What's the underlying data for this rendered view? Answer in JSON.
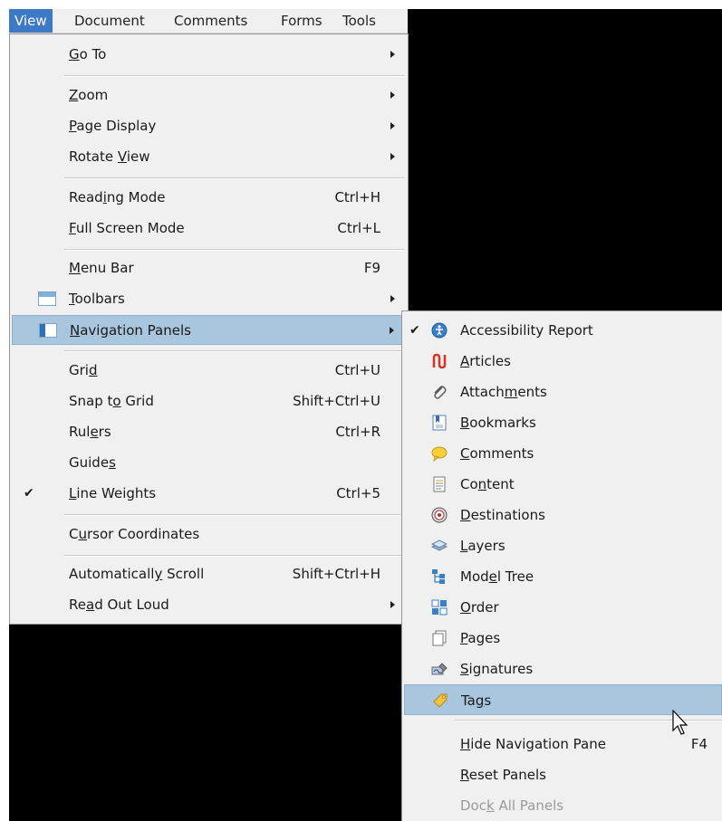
{
  "menubar": {
    "items": [
      "View",
      "Document",
      "Comments",
      "Forms",
      "Tools"
    ],
    "active_index": 0,
    "accent": "#3d79c4"
  },
  "view_menu": {
    "items": [
      {
        "label": "Go To",
        "mnemonic": "G",
        "submenu": true
      },
      {
        "label": "Zoom",
        "mnemonic": "Z",
        "submenu": true
      },
      {
        "label": "Page Display",
        "mnemonic": "P",
        "submenu": true
      },
      {
        "label": "Rotate View",
        "mnemonic": "V",
        "submenu": true
      },
      {
        "label": "Reading Mode",
        "mnemonic": "i",
        "shortcut": "Ctrl+H"
      },
      {
        "label": "Full Screen Mode",
        "mnemonic": "F",
        "shortcut": "Ctrl+L"
      },
      {
        "label": "Menu Bar",
        "mnemonic": "M",
        "shortcut": "F9"
      },
      {
        "label": "Toolbars",
        "mnemonic": "T",
        "submenu": true,
        "icon": "toolbars-icon"
      },
      {
        "label": "Navigation Panels",
        "mnemonic": "N",
        "submenu": true,
        "icon": "navigation-panels-icon",
        "highlighted": true
      },
      {
        "label": "Grid",
        "mnemonic": "d",
        "shortcut": "Ctrl+U"
      },
      {
        "label": "Snap to Grid",
        "mnemonic": "o",
        "shortcut": "Shift+Ctrl+U"
      },
      {
        "label": "Rulers",
        "mnemonic": "e",
        "shortcut": "Ctrl+R"
      },
      {
        "label": "Guides",
        "mnemonic": "s"
      },
      {
        "label": "Line Weights",
        "mnemonic": "L",
        "shortcut": "Ctrl+5",
        "checked": true
      },
      {
        "label": "Cursor Coordinates",
        "mnemonic": "u"
      },
      {
        "label": "Automatically Scroll",
        "mnemonic": "y",
        "shortcut": "Shift+Ctrl+H"
      },
      {
        "label": "Read Out Loud",
        "mnemonic": "a",
        "submenu": true
      }
    ]
  },
  "nav_submenu": {
    "items": [
      {
        "label": "Accessibility Report",
        "icon": "accessibility-report-icon",
        "checked": true
      },
      {
        "label": "Articles",
        "mnemonic": "A",
        "icon": "articles-icon"
      },
      {
        "label": "Attachments",
        "mnemonic": "m",
        "icon": "paperclip-icon"
      },
      {
        "label": "Bookmarks",
        "mnemonic": "B",
        "icon": "bookmarks-icon"
      },
      {
        "label": "Comments",
        "mnemonic": "C",
        "icon": "comment-bubble-icon"
      },
      {
        "label": "Content",
        "mnemonic": "n",
        "icon": "content-icon"
      },
      {
        "label": "Destinations",
        "mnemonic": "D",
        "icon": "destinations-icon"
      },
      {
        "label": "Layers",
        "mnemonic": "L",
        "icon": "layers-icon"
      },
      {
        "label": "Model Tree",
        "mnemonic": "e",
        "icon": "model-tree-icon"
      },
      {
        "label": "Order",
        "mnemonic": "O",
        "icon": "order-icon"
      },
      {
        "label": "Pages",
        "mnemonic": "P",
        "icon": "pages-icon"
      },
      {
        "label": "Signatures",
        "mnemonic": "S",
        "icon": "signatures-icon"
      },
      {
        "label": "Tags",
        "mnemonic": "g",
        "icon": "tag-icon",
        "highlighted": true
      },
      {
        "label": "Hide Navigation Pane",
        "mnemonic": "H",
        "shortcut": "F4"
      },
      {
        "label": "Reset Panels",
        "mnemonic": "R"
      },
      {
        "label": "Dock All Panels",
        "mnemonic": "k",
        "disabled": true
      }
    ]
  },
  "colors": {
    "menu_bg": "#f0f0f0",
    "highlight": "#a9c6df",
    "disabled_text": "#9a9a9a"
  }
}
